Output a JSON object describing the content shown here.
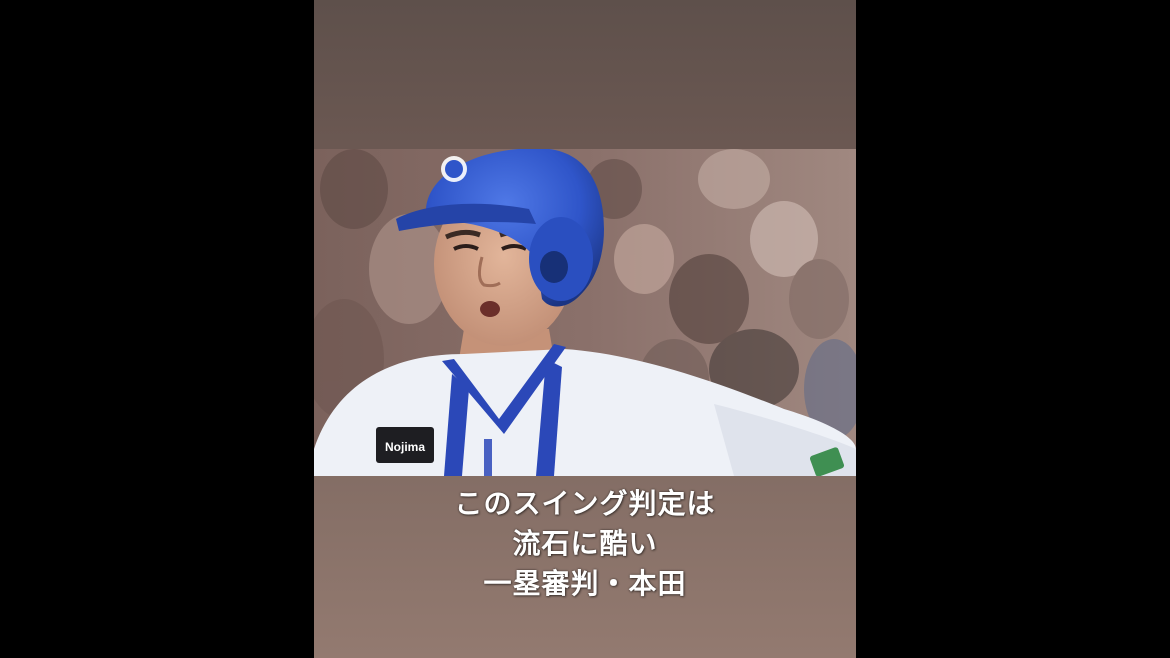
{
  "caption": {
    "line1": "このスイング判定は",
    "line2": "流石に酷い",
    "line3": "一塁審判・本田"
  },
  "photo": {
    "subject": "batter in blue helmet and white jersey",
    "jersey_patch_text": "Nojima"
  },
  "colors": {
    "outer_background": "#000000",
    "panel_top": "#5e504b",
    "panel_bottom": "#937a70",
    "helmet": "#2f55c9",
    "jersey": "#eef1f7",
    "stripe": "#2b48b8"
  }
}
